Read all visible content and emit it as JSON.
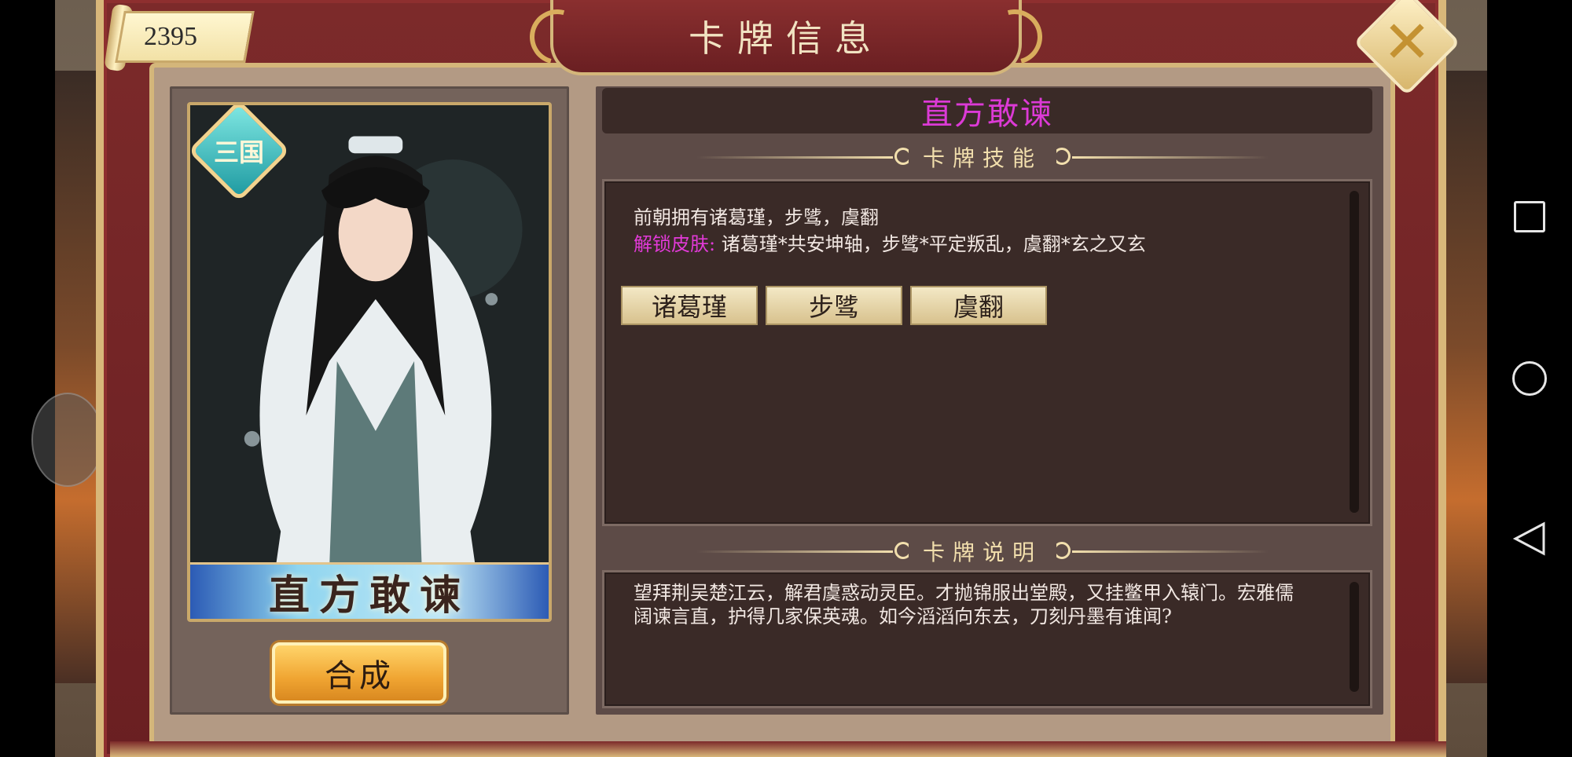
{
  "window": {
    "title": "卡牌信息"
  },
  "coins": {
    "value": "2395"
  },
  "card": {
    "badge": "三国",
    "name": "直方敢谏",
    "merge_button": "合成"
  },
  "detail": {
    "name": "直方敢谏",
    "skill_section_title": "卡牌技能",
    "skill_line1": "前朝拥有诸葛瑾，步骘，虞翻",
    "skin_label": "解锁皮肤:",
    "skin_text": "诸葛瑾*共安坤轴，步骘*平定叛乱，虞翻*玄之又玄",
    "skins": [
      "诸葛瑾",
      "步骘",
      "虞翻"
    ],
    "desc_section_title": "卡牌说明",
    "description_line1": "望拜荆吴楚江云，解君虞惑动灵臣。才抛锦服出堂殿，又挂鳖甲入辕门。宏雅儒",
    "description_line2": "阔谏言直，护得几家保英魂。如今滔滔向东去，刀刻丹墨有谁闻?"
  },
  "colors": {
    "accent_pink": "#dc3ad6",
    "gold": "#d4b67a",
    "frame_red": "#7c2a2a"
  },
  "icons": {
    "close": "close-icon",
    "nav_recent": "nav-recent-apps-icon",
    "nav_home": "nav-home-icon",
    "nav_back": "nav-back-icon"
  }
}
